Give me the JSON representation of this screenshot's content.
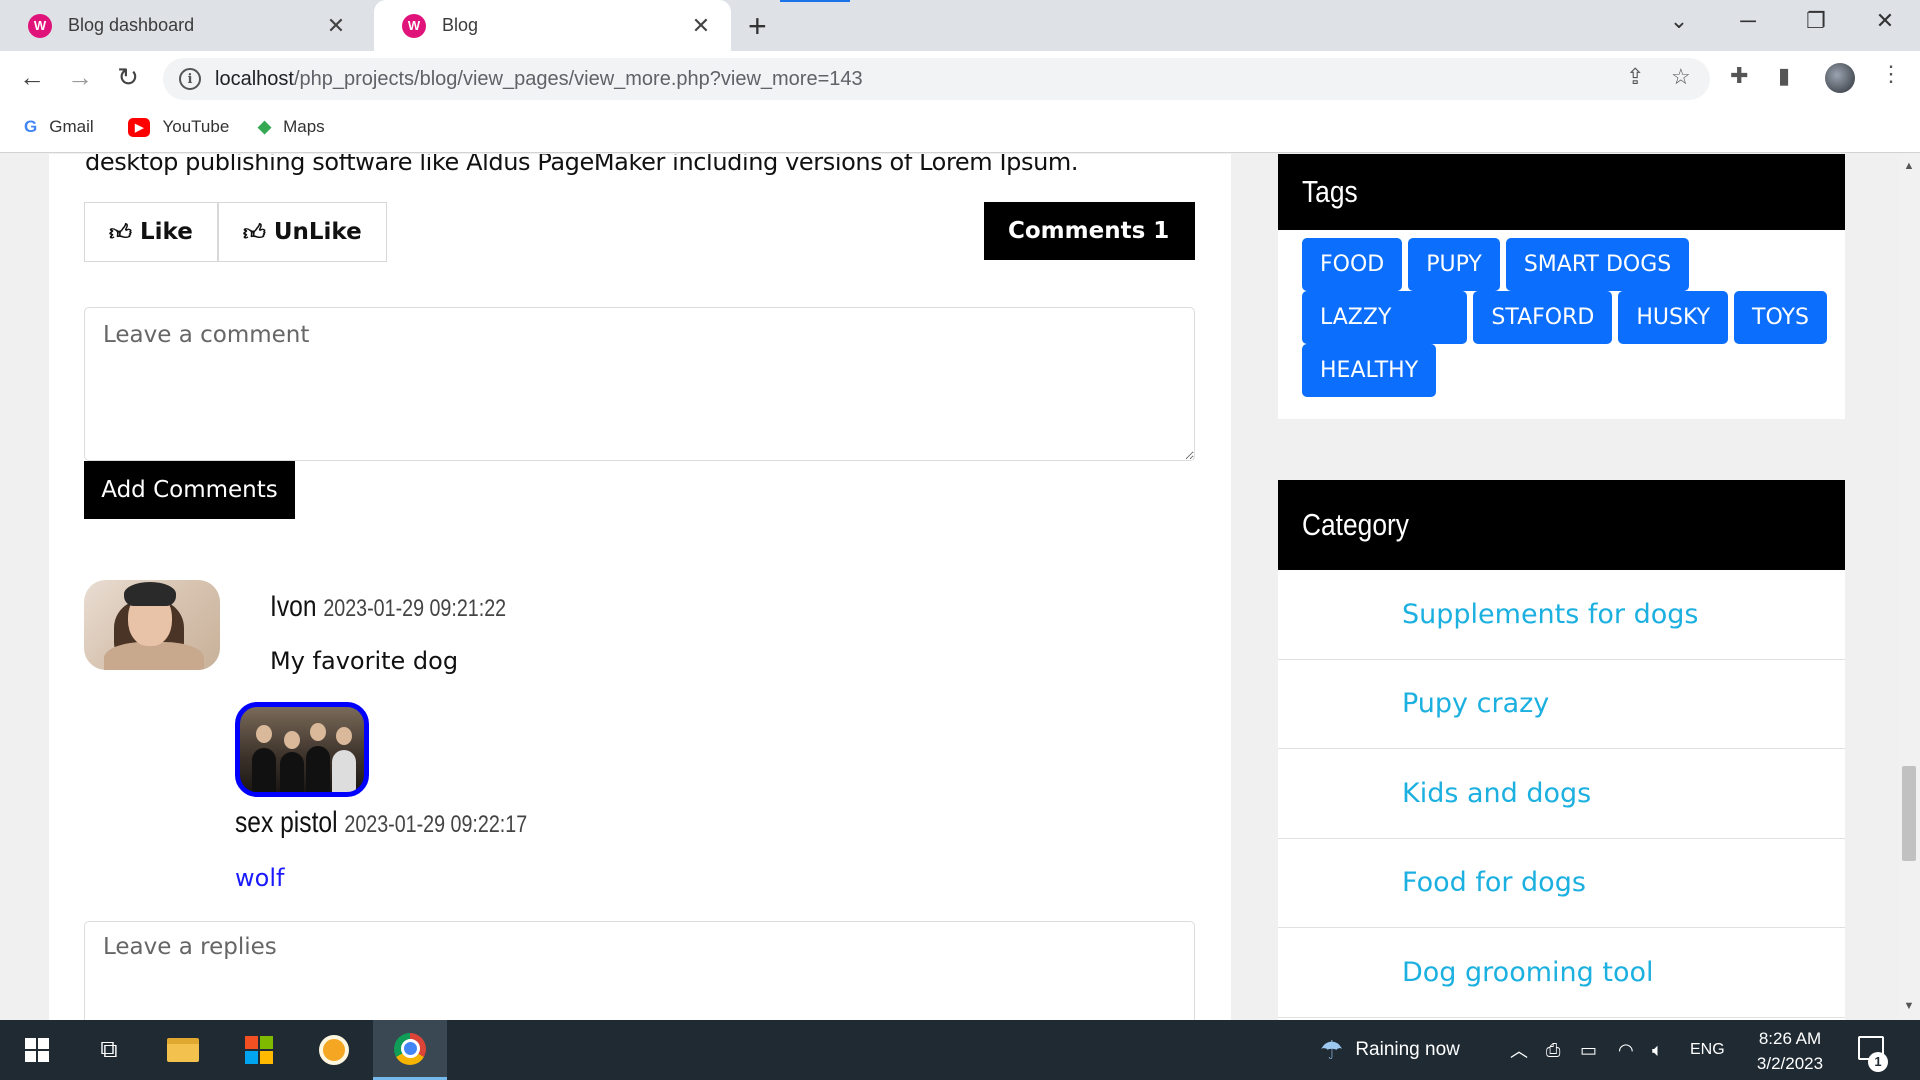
{
  "browser": {
    "tabs": [
      {
        "title": "Blog dashboard",
        "favicon": "W"
      },
      {
        "title": "Blog",
        "favicon": "W"
      }
    ],
    "url_host": "localhost",
    "url_path": "/php_projects/blog/view_pages/view_more.php?view_more=143",
    "bookmarks": [
      {
        "label": "Gmail",
        "icon": "google-icon"
      },
      {
        "label": "YouTube",
        "icon": "youtube-icon"
      },
      {
        "label": "Maps",
        "icon": "maps-icon"
      }
    ]
  },
  "post": {
    "description_tail": "desktop publishing software like Aldus PageMaker including versions of Lorem Ipsum.",
    "like_label": "Like",
    "unlike_label": "UnLike",
    "comments_label": "Comments 1"
  },
  "comment_form": {
    "placeholder": "Leave a comment",
    "submit_label": "Add Comments"
  },
  "comments": [
    {
      "author": "Ivon",
      "date": "2023-01-29 09:21:22",
      "text": "My favorite dog",
      "replies": [
        {
          "author": "sex pistol",
          "date": "2023-01-29 09:22:17",
          "text": "wolf"
        }
      ]
    }
  ],
  "reply_form": {
    "placeholder": "Leave a replies"
  },
  "sidebar": {
    "tags_title": "Tags",
    "tag_rows": [
      [
        "FOOD",
        "PUPY",
        "SMART DOGS"
      ],
      [
        "LAZZY DOGS",
        "STAFORD",
        "HUSKY",
        "TOYS"
      ],
      [
        "HEALTHY"
      ]
    ],
    "category_title": "Category",
    "categories": [
      "Supplements for dogs",
      "Pupy crazy",
      "Kids and dogs",
      "Food for dogs",
      "Dog grooming tool"
    ]
  },
  "taskbar": {
    "weather": "Raining now",
    "language": "ENG",
    "time": "8:26 AM",
    "date": "3/2/2023",
    "notifications": "1"
  },
  "colors": {
    "tag_bg": "#0b6efd",
    "category_link": "#1bb0e0",
    "reply_text": "#1a1aff",
    "reply_avatar_border": "#0000ff"
  }
}
